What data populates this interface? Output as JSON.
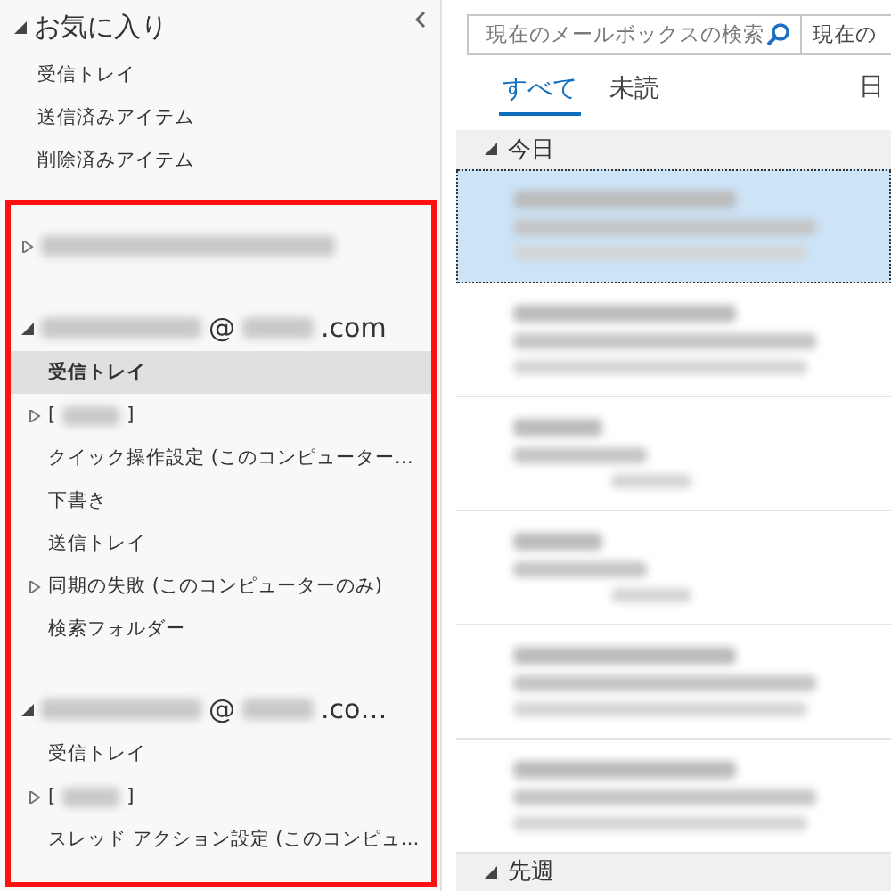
{
  "favorites": {
    "title": "お気に入り",
    "expanded": true,
    "items": [
      {
        "label": "受信トレイ"
      },
      {
        "label": "送信済みアイテム"
      },
      {
        "label": "削除済みアイテム"
      }
    ]
  },
  "accounts": [
    {
      "expanded": false
    },
    {
      "expanded": true,
      "at": "@",
      "domain": ".com",
      "items": [
        {
          "label": "受信トレイ",
          "selected": true,
          "kind": "plain",
          "expandable": false
        },
        {
          "label": "[",
          "suffix": "]",
          "selected": false,
          "kind": "blurred",
          "expandable": true
        },
        {
          "label": "クイック操作設定 (このコンピューター…",
          "selected": false,
          "kind": "plain",
          "expandable": false
        },
        {
          "label": "下書き",
          "selected": false,
          "kind": "plain",
          "expandable": false
        },
        {
          "label": "送信トレイ",
          "selected": false,
          "kind": "plain",
          "expandable": false
        },
        {
          "label": "同期の失敗 (このコンピューターのみ)",
          "selected": false,
          "kind": "plain",
          "expandable": true
        },
        {
          "label": "検索フォルダー",
          "selected": false,
          "kind": "plain",
          "expandable": false
        }
      ]
    },
    {
      "expanded": true,
      "at": "@",
      "domain": ".co…",
      "items": [
        {
          "label": "受信トレイ",
          "selected": false,
          "kind": "plain",
          "expandable": false
        },
        {
          "label": "[",
          "suffix": "]",
          "selected": false,
          "kind": "blurred",
          "expandable": true
        },
        {
          "label": "スレッド アクション設定 (このコンピュ…",
          "selected": false,
          "kind": "plain",
          "expandable": false
        }
      ]
    }
  ],
  "search": {
    "placeholder": "現在のメールボックスの検索",
    "scope": "現在の"
  },
  "tabs": [
    {
      "label": "すべて",
      "selected": true
    },
    {
      "label": "未読",
      "selected": false
    }
  ],
  "sort_label": "日",
  "groups": [
    {
      "title": "今日",
      "expanded": true,
      "messages": [
        {
          "kind": "mail",
          "selected": true
        },
        {
          "kind": "mail",
          "selected": false
        },
        {
          "kind": "notice",
          "selected": false
        },
        {
          "kind": "notice",
          "selected": false
        },
        {
          "kind": "mail",
          "selected": false
        },
        {
          "kind": "mail",
          "selected": false
        }
      ]
    },
    {
      "title": "先週",
      "expanded": true
    }
  ]
}
